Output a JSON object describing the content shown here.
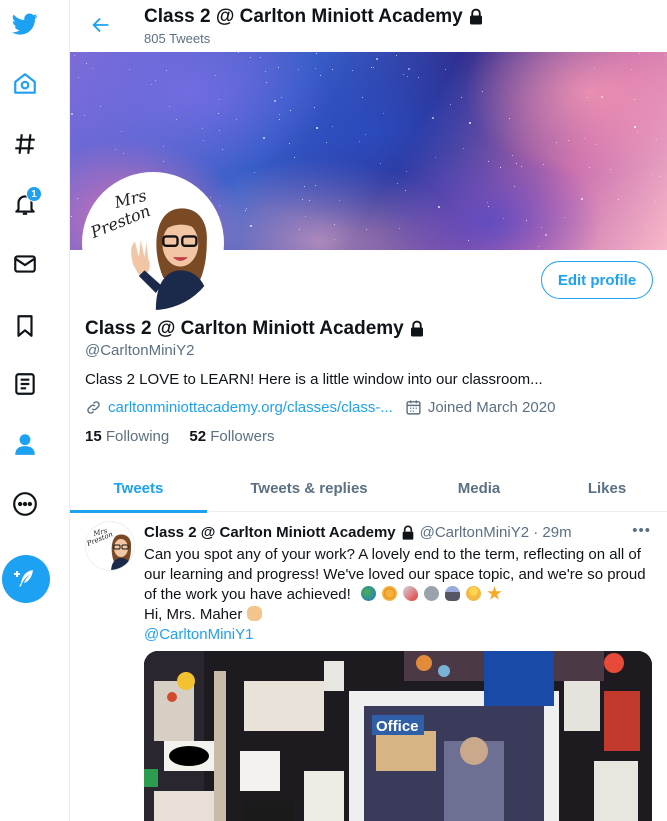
{
  "topbar": {
    "title": "Class 2 @ Carlton Miniott Academy",
    "tweet_count": "805 Tweets"
  },
  "profile": {
    "avatar_text_line1": "Mrs",
    "avatar_text_line2": "Preston",
    "edit_label": "Edit profile",
    "name": "Class 2 @ Carlton Miniott Academy",
    "handle": "@CarltonMiniY2",
    "bio": "Class 2 LOVE to LEARN! Here is a little window into our classroom...",
    "link": "carltonminiottacademy.org/classes/class-...",
    "joined": "Joined March 2020",
    "following_count": "15",
    "following_label": "Following",
    "followers_count": "52",
    "followers_label": "Followers"
  },
  "notifications_badge": "1",
  "tabs": [
    {
      "label": "Tweets",
      "active": true
    },
    {
      "label": "Tweets & replies",
      "active": false
    },
    {
      "label": "Media",
      "active": false
    },
    {
      "label": "Likes",
      "active": false
    }
  ],
  "tweet": {
    "name": "Class 2 @ Carlton Miniott Academy",
    "handle_time": "@CarltonMiniY2 · 29m",
    "more": "•••",
    "line1": "Can you spot any of your work? A lovely end to the term, reflecting on all of",
    "line2": "our learning and progress! We've loved our space topic, and we're so proud",
    "line3": "of the work you have achieved!",
    "line4": "Hi, Mrs. Maher",
    "mention": "@CarltonMiniY1",
    "media_sign": "Office"
  },
  "colors": {
    "accent": "#1da1f2",
    "text": "#0f1419",
    "muted": "#5b7083"
  }
}
